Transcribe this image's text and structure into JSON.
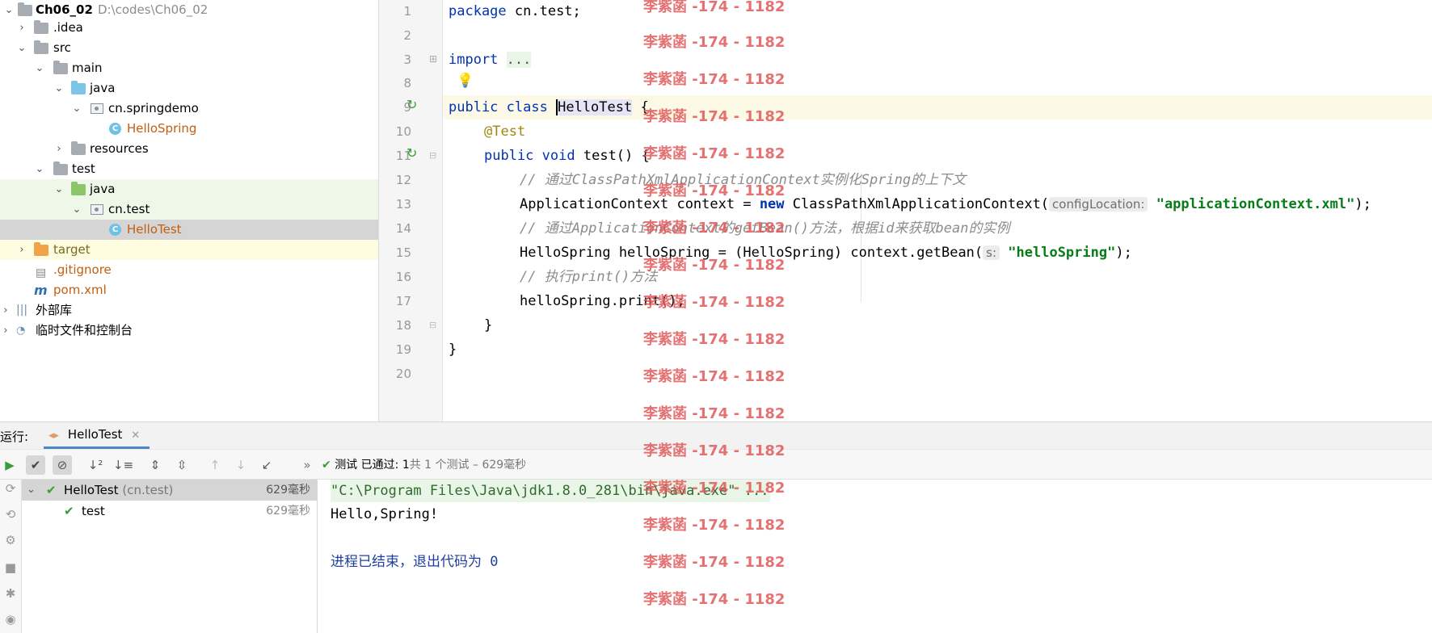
{
  "project_tree": {
    "root_name": "Ch06_02",
    "root_path": "D:\\codes\\Ch06_02",
    "items": [
      {
        "label": ".idea"
      },
      {
        "label": "src"
      },
      {
        "label": "main"
      },
      {
        "label": "java"
      },
      {
        "label": "cn.springdemo"
      },
      {
        "label": "HelloSpring"
      },
      {
        "label": "resources"
      },
      {
        "label": "test"
      },
      {
        "label": "java"
      },
      {
        "label": "cn.test"
      },
      {
        "label": "HelloTest"
      },
      {
        "label": "target"
      },
      {
        "label": ".gitignore"
      },
      {
        "label": "pom.xml"
      },
      {
        "label": "外部库"
      },
      {
        "label": "临时文件和控制台"
      }
    ]
  },
  "editor": {
    "line_numbers": [
      "1",
      "2",
      "3",
      "8",
      "9",
      "10",
      "11",
      "12",
      "13",
      "14",
      "15",
      "16",
      "17",
      "18",
      "19",
      "20"
    ],
    "lines": {
      "l1_kw": "package",
      "l1_rest": " cn.test;",
      "l3_kw": "import",
      "l3_fold": "...",
      "l9_kw1": "public",
      "l9_kw2": "class",
      "l9_name": "HelloTest",
      "l9_brace": " {",
      "l10_ann": "@Test",
      "l11_kw1": "public",
      "l11_kw2": "void",
      "l11_rest": " test() {",
      "l12_cmt": "// 通过ClassPathXmlApplicationContext实例化Spring的上下文",
      "l13_a": "ApplicationContext context = ",
      "l13_new": "new",
      "l13_b": " ClassPathXmlApplicationContext(",
      "l13_hint": "configLocation:",
      "l13_str": "\"applicationContext.xml\"",
      "l13_end": ");",
      "l14_cmt": "// 通过ApplicationContext的getBean()方法，根据id来获取bean的实例",
      "l15_a": "HelloSpring helloSpring = (HelloSpring) context.getBean(",
      "l15_hint": "s:",
      "l15_str": "\"helloSpring\"",
      "l15_end": ");",
      "l16_cmt": "// 执行print()方法",
      "l17": "helloSpring.print();",
      "l18": "}",
      "l19": "}"
    }
  },
  "run": {
    "label": "运行:",
    "tab_name": "HelloTest",
    "status_prefix": "测试 已通过:",
    "status_count": "1",
    "status_suffix": "共 1 个测试 – 629毫秒",
    "tests": [
      {
        "name": "HelloTest",
        "pkg": "(cn.test)",
        "duration": "629毫秒"
      },
      {
        "name": "test",
        "pkg": "",
        "duration": "629毫秒"
      }
    ],
    "console": [
      "\"C:\\Program Files\\Java\\jdk1.8.0_281\\bin\\java.exe\" ...",
      "Hello,Spring!",
      "进程已结束，退出代码为 0"
    ]
  },
  "watermark": "李紫菡 -174 - 1182",
  "colors": {
    "keyword": "#0033b3",
    "annotation": "#9e880d",
    "string": "#067d17",
    "comment": "#8c8c8c",
    "pass_green": "#3a9b3a",
    "watermark": "#e05a5a"
  }
}
